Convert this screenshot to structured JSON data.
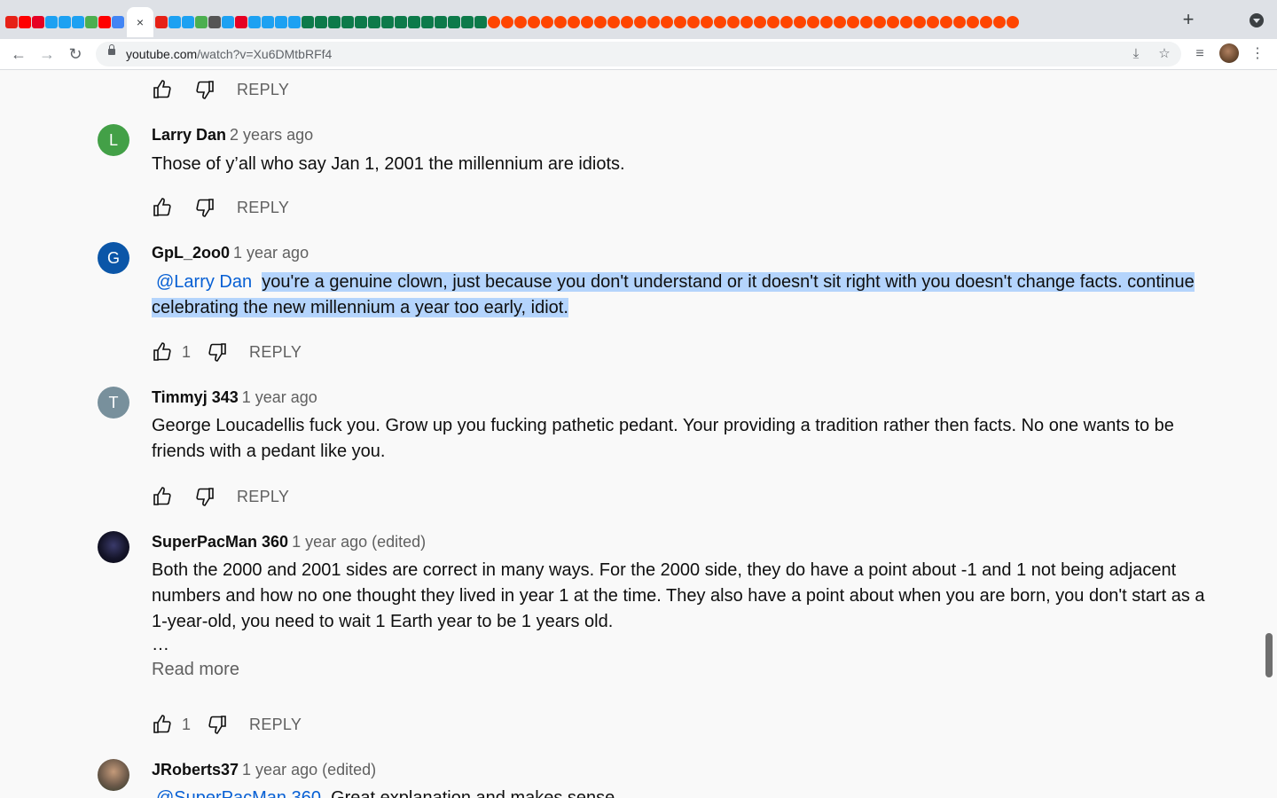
{
  "browser": {
    "tab_favicons": [
      "#e62117",
      "#ff0000",
      "#e60023",
      "#1da1f2",
      "#1da1f2",
      "#1da1f2",
      "#4caf50",
      "#ff0000",
      "#4285f4"
    ],
    "url_host": "youtube.com",
    "url_path": "/watch?v=Xu6DMtbRFf4",
    "close_tab": "×",
    "new_tab": "+"
  },
  "comments": [
    {
      "author": "Larry Dan",
      "time": "2 years ago",
      "avatar_letter": "L",
      "avatar_color": "#43a047",
      "text": "Those of y’all who say Jan 1, 2001 the millennium are idiots.",
      "likes": "",
      "reply": "REPLY"
    },
    {
      "author": "GpL_2oo0",
      "time": "1 year ago",
      "avatar_letter": "G",
      "avatar_color": "#0b56a8",
      "mention": "@Larry Dan",
      "text": "you're a genuine clown, just because you don't understand or it doesn't sit right with you doesn't change facts. continue celebrating the new millennium a year too early, idiot.",
      "likes": "1",
      "reply": "REPLY"
    },
    {
      "author": "Timmyj 343",
      "time": "1 year ago",
      "avatar_letter": "T",
      "avatar_color": "#78909c",
      "text": "George Loucadellis fuck you. Grow up you fucking pathetic pedant. Your providing a tradition rather then facts. No one wants to be friends with a pedant like you.",
      "likes": "",
      "reply": "REPLY"
    },
    {
      "author": "SuperPacMan 360",
      "time": "1 year ago (edited)",
      "text": "Both the 2000 and 2001 sides are correct in many ways. For the 2000 side, they do have a point about -1 and 1 not being adjacent numbers and how no one thought they lived in year 1 at the time. They also have a point about when you are born, you don't start as a 1-year-old, you need to wait 1 Earth year to be 1 years old.",
      "ellipsis": "…",
      "read_more": "Read more",
      "likes": "1",
      "reply": "REPLY"
    },
    {
      "author": "JRoberts37",
      "time": "1 year ago (edited)",
      "mention": "@SuperPacMan 360",
      "text": "Great explanation and makes sense."
    }
  ],
  "top_reply": "REPLY"
}
